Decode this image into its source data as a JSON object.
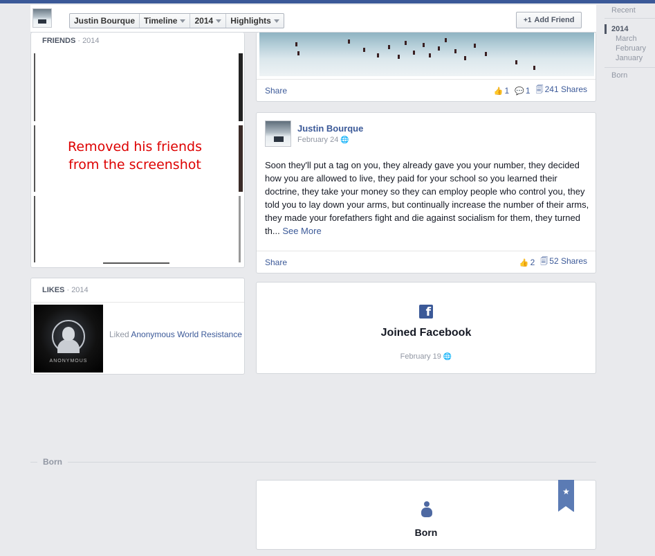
{
  "header": {
    "profile_name": "Justin Bourque",
    "timeline_label": "Timeline",
    "year_label": "2014",
    "filter_label": "Highlights",
    "add_friend_label": "Add Friend",
    "add_friend_icon": "+1"
  },
  "scrubber": {
    "recent": "Recent",
    "year": "2014",
    "months": [
      "March",
      "February",
      "January"
    ],
    "born": "Born"
  },
  "friends": {
    "title": "FRIENDS",
    "year": "· 2014",
    "overlay_note_line1": "Removed his friends",
    "overlay_note_line2": "from the screenshot"
  },
  "likes": {
    "title": "LIKES",
    "year": "· 2014",
    "liked_prefix": "Liked",
    "liked_page": "Anonymous World Resistance",
    "image_caption": "ANONYMOUS"
  },
  "photo_post": {
    "share_label": "Share",
    "likes_count": "1",
    "comments_count": "1",
    "shares_label": "241 Shares"
  },
  "text_post": {
    "author": "Justin Bourque",
    "date": "February 24",
    "body": "Soon they'll put a tag on you, they already gave you your number, they decided how you are allowed to live, they paid for your school so you learned their doctrine, they take your money so they can employ people who control you, they told you to lay down your arms, but continually increase the number of their arms, they made your forefathers fight and die against socialism for them, they turned th...",
    "see_more": "See More",
    "share_label": "Share",
    "likes_count": "2",
    "shares_label": "52 Shares"
  },
  "joined": {
    "title": "Joined Facebook",
    "date": "February 19"
  },
  "born_section": {
    "divider_label": "Born",
    "card_title": "Born"
  },
  "colors": {
    "brand": "#3b5998",
    "background": "#e9eaed",
    "note_red": "#dd0000"
  }
}
